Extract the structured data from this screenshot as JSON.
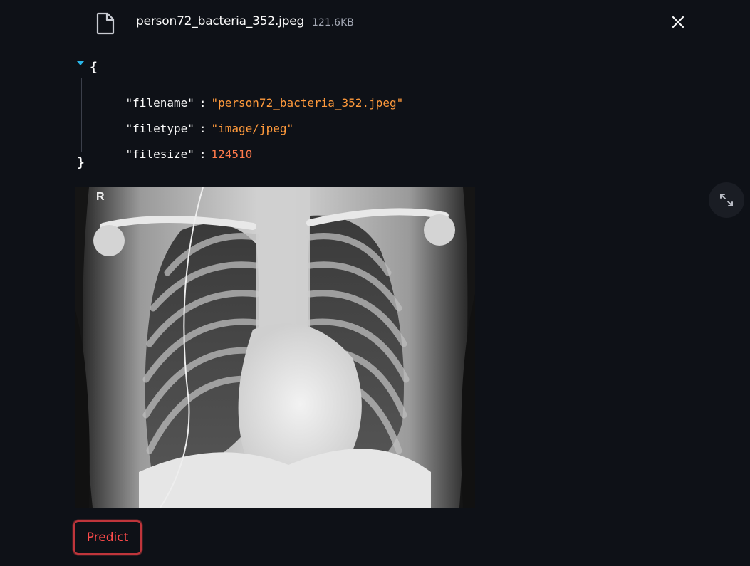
{
  "uploaded_file": {
    "name": "person72_bacteria_352.jpeg",
    "size": "121.6KB",
    "icon": "file-icon",
    "close_icon": "close-icon"
  },
  "json_view": {
    "open_brace": "{",
    "close_brace": "}",
    "entries": [
      {
        "key": "\"filename\"",
        "value": "\"person72_bacteria_352.jpeg\"",
        "type": "string"
      },
      {
        "key": "\"filetype\"",
        "value": "\"image/jpeg\"",
        "type": "string"
      },
      {
        "key": "\"filesize\"",
        "value": "124510",
        "type": "number"
      }
    ],
    "colon": ":"
  },
  "image": {
    "corner_marker": "R",
    "fullscreen_icon": "expand-icon"
  },
  "actions": {
    "predict_label": "Predict"
  },
  "colors": {
    "background": "#0e1117",
    "accent": "#ff4b4b",
    "json_string": "#ff9a3c",
    "json_number": "#ff7a4c",
    "caret": "#29b5e8"
  }
}
